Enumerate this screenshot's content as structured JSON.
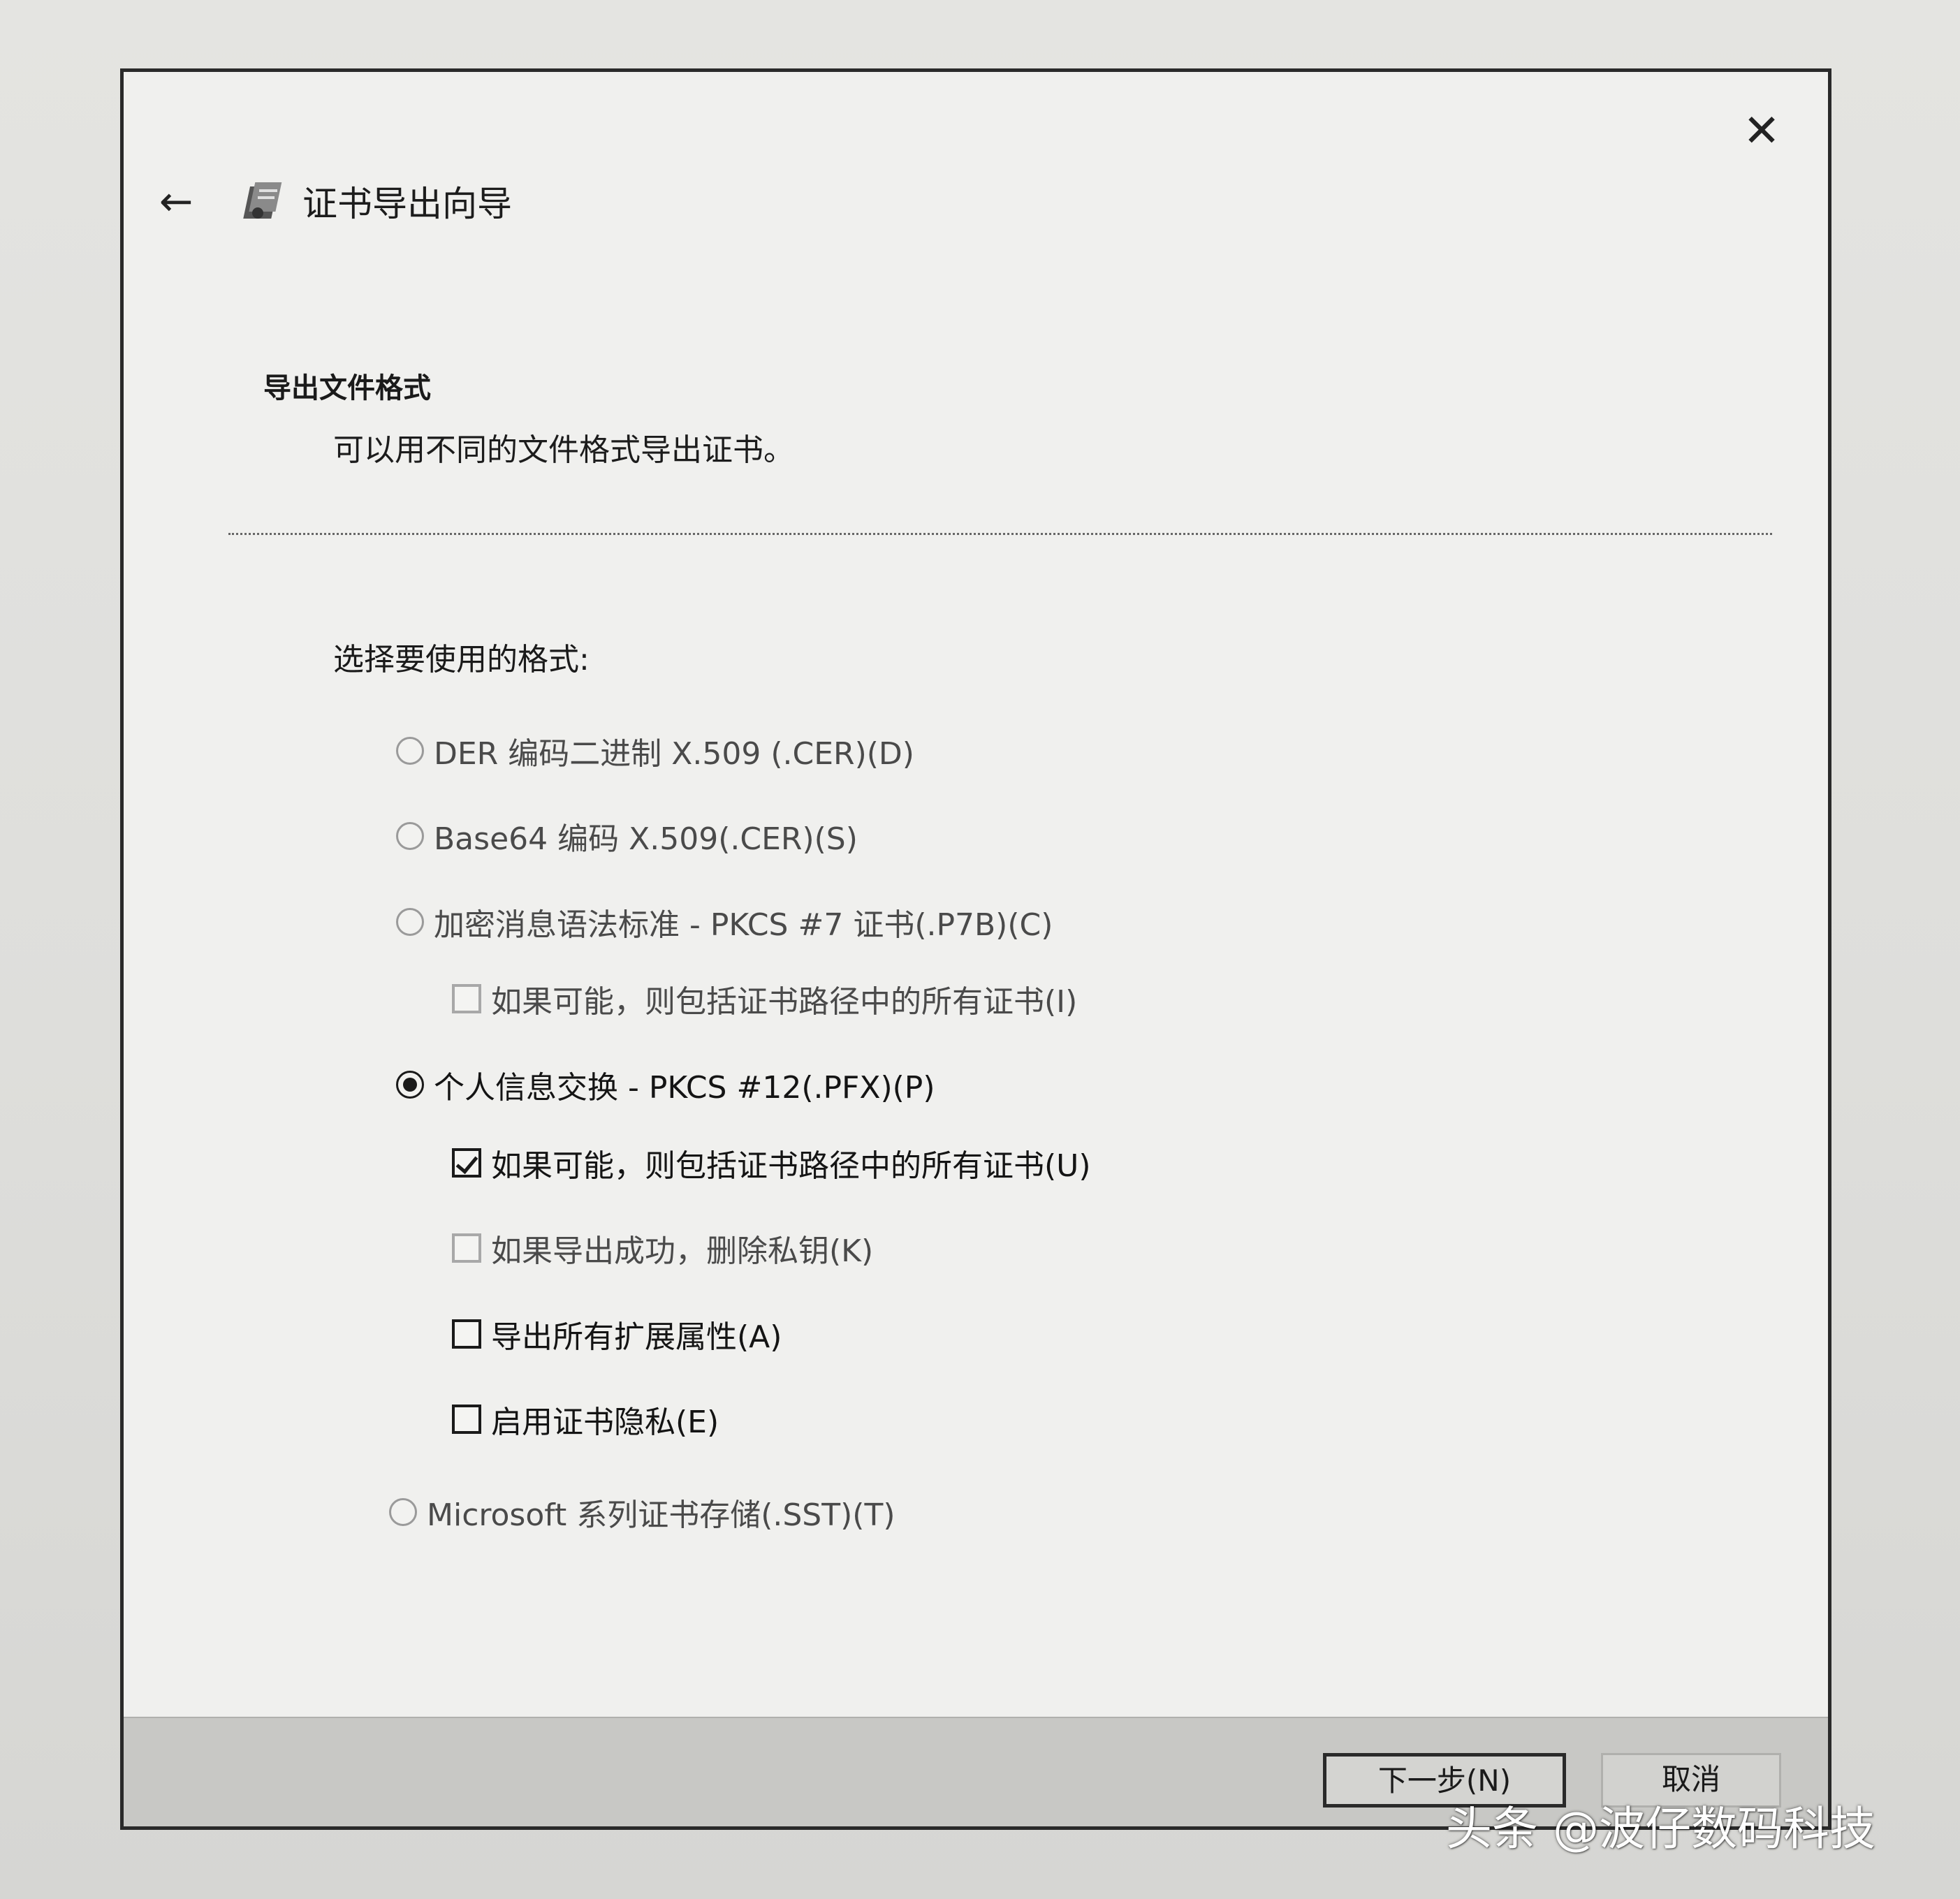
{
  "window": {
    "title": "证书导出向导",
    "close_glyph": "✕",
    "back_glyph": "←"
  },
  "section": {
    "title": "导出文件格式",
    "description": "可以用不同的文件格式导出证书。"
  },
  "choose_label": "选择要使用的格式:",
  "options": {
    "der": "DER 编码二进制 X.509 (.CER)(D)",
    "base64": "Base64 编码 X.509(.CER)(S)",
    "pkcs7": "加密消息语法标准 - PKCS #7 证书(.P7B)(C)",
    "pkcs7_include": "如果可能，则包括证书路径中的所有证书(I)",
    "pkcs12": "个人信息交换 - PKCS #12(.PFX)(P)",
    "pkcs12_include": "如果可能，则包括证书路径中的所有证书(U)",
    "pkcs12_delete_key": "如果导出成功，删除私钥(K)",
    "pkcs12_export_ext": "导出所有扩展属性(A)",
    "pkcs12_privacy": "启用证书隐私(E)",
    "sst": "Microsoft 系列证书存储(.SST)(T)"
  },
  "buttons": {
    "next": "下一步(N)",
    "cancel": "取消"
  },
  "watermark": "头条 @波仔数码科技"
}
